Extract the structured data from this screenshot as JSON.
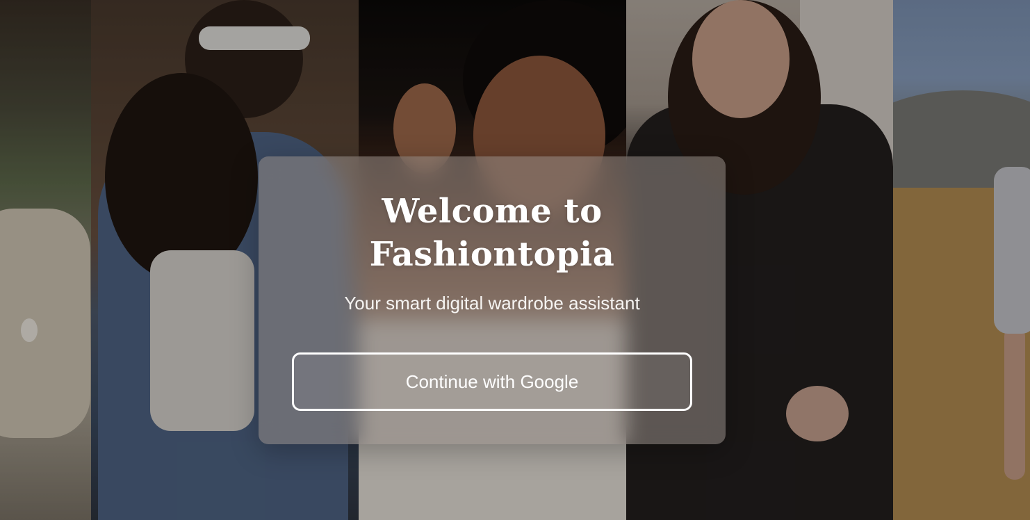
{
  "background": {
    "photos": [
      "photo-lounge-cushion",
      "photo-couple-denim",
      "photo-woman-glam-makeup",
      "photo-woman-pinstripe-blazer",
      "photo-woman-field-dress"
    ],
    "overlay_color": "#000000"
  },
  "welcome_card": {
    "title_line1": "Welcome to",
    "title_line2": "Fashiontopia",
    "subtitle": "Your smart digital wardrobe assistant",
    "google_button_label": "Continue with Google"
  },
  "colors": {
    "card_tint": "#968c86",
    "text": "#ffffff",
    "button_border": "#ffffff"
  }
}
